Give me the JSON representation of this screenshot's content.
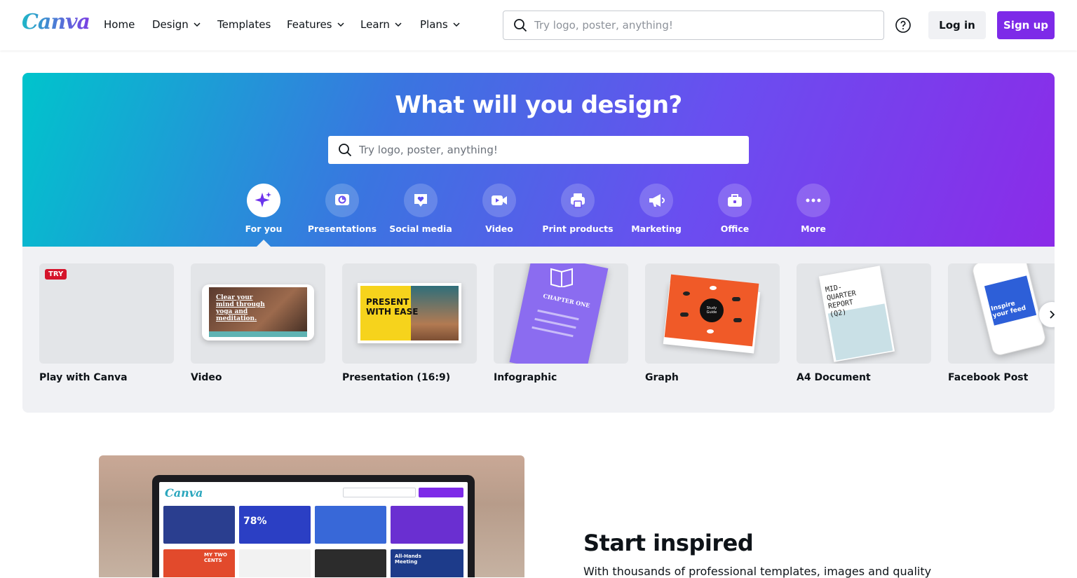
{
  "brand": {
    "logo_text": "Canva",
    "accent": "#7d2ae8",
    "teal": "#00c4cc"
  },
  "nav": {
    "items": [
      {
        "label": "Home",
        "has_dropdown": false
      },
      {
        "label": "Design",
        "has_dropdown": true
      },
      {
        "label": "Templates",
        "has_dropdown": false
      },
      {
        "label": "Features",
        "has_dropdown": true
      },
      {
        "label": "Learn",
        "has_dropdown": true
      },
      {
        "label": "Plans",
        "has_dropdown": true
      }
    ],
    "search_placeholder": "Try logo, poster, anything!",
    "login_label": "Log in",
    "signup_label": "Sign up"
  },
  "hero": {
    "title": "What will you design?",
    "search_placeholder": "Try logo, poster, anything!",
    "categories": [
      {
        "label": "For you",
        "icon": "sparkle-icon",
        "active": true
      },
      {
        "label": "Presentations",
        "icon": "presentation-icon",
        "active": false
      },
      {
        "label": "Social media",
        "icon": "heart-chat-icon",
        "active": false
      },
      {
        "label": "Video",
        "icon": "video-camera-icon",
        "active": false
      },
      {
        "label": "Print products",
        "icon": "printer-icon",
        "active": false
      },
      {
        "label": "Marketing",
        "icon": "megaphone-icon",
        "active": false
      },
      {
        "label": "Office",
        "icon": "briefcase-icon",
        "active": false
      },
      {
        "label": "More",
        "icon": "more-dots-icon",
        "active": false
      }
    ]
  },
  "tray": {
    "cards": [
      {
        "label": "Play with Canva",
        "badge": "TRY"
      },
      {
        "label": "Video",
        "thumb_text": "Clear your mind through yoga and meditation."
      },
      {
        "label": "Presentation (16:9)",
        "thumb_text": "PRESENT WITH EASE"
      },
      {
        "label": "Infographic",
        "thumb_text": "CHAPTER ONE"
      },
      {
        "label": "Graph",
        "thumb_text": "Study Guide"
      },
      {
        "label": "A4 Document",
        "thumb_text": "MID-QUARTER REPORT (Q2)"
      },
      {
        "label": "Facebook Post",
        "thumb_text": "Inspire your feed"
      }
    ]
  },
  "inspired": {
    "title": "Start inspired",
    "text": "With thousands of professional templates, images and quality",
    "mock_logo": "Canva",
    "mock_tile_text_1": "78%",
    "mock_tile_text_2": "All-Hands Meeting",
    "mock_tile_text_3": "MY TWO CENTS"
  }
}
